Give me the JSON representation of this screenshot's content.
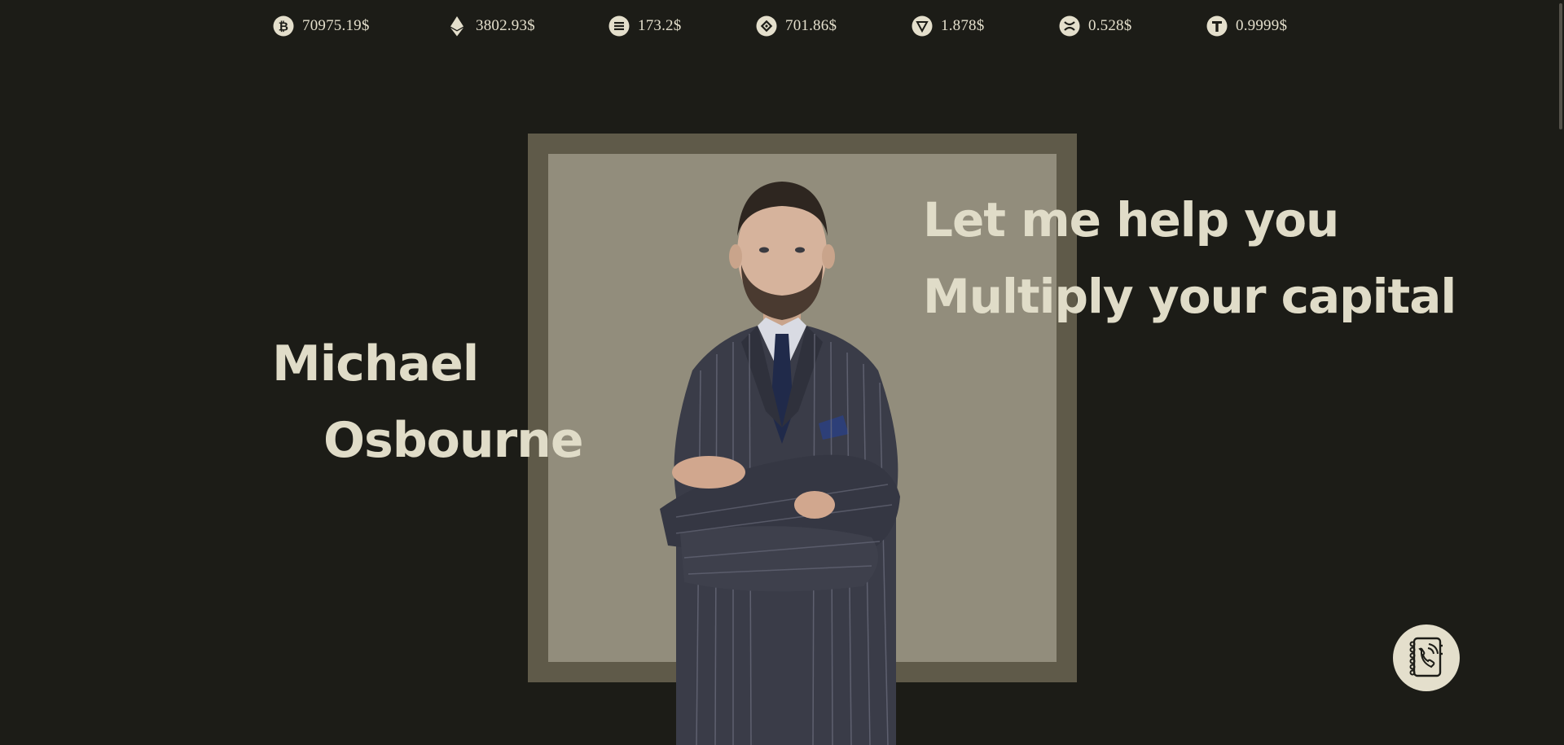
{
  "ticker": [
    {
      "icon": "bitcoin-icon",
      "price": "70975.19$"
    },
    {
      "icon": "ethereum-icon",
      "price": "3802.93$"
    },
    {
      "icon": "solana-icon",
      "price": "173.2$"
    },
    {
      "icon": "bnb-icon",
      "price": "701.86$"
    },
    {
      "icon": "tron-icon",
      "price": "1.878$"
    },
    {
      "icon": "xrp-icon",
      "price": "0.528$"
    },
    {
      "icon": "tether-icon",
      "price": "0.9999$"
    }
  ],
  "hero": {
    "first_name": "Michael",
    "last_name": "Osbourne",
    "tagline_line1": "Let me help you",
    "tagline_line2": "Multiply your capital"
  },
  "contact": {
    "icon": "phone-contact-book-icon"
  },
  "colors": {
    "background": "#1c1c17",
    "text": "#e0dcc8",
    "frame_outer": "#5f5a49",
    "frame_inner": "#928d7c"
  }
}
